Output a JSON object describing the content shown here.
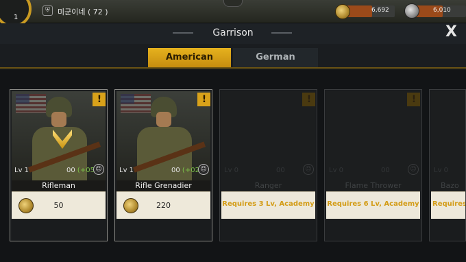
{
  "topbar": {
    "level": "1",
    "player_name": "미군이네 ( 72 )",
    "rank_icon": "shield-rank-icon",
    "gold": "6,692",
    "gold_fill": 0.55,
    "steel": "6,010",
    "steel_fill": 0.55
  },
  "window": {
    "title": "Garrison",
    "close_label": "X"
  },
  "tabs": [
    {
      "label": "American",
      "active": true
    },
    {
      "label": "German",
      "active": false
    }
  ],
  "units": [
    {
      "name": "Rifleman",
      "level": "Lv 1",
      "stat": "00",
      "stat_bonus": "(+05)",
      "cost": "50",
      "locked": false,
      "warn": "!"
    },
    {
      "name": "Rifle Grenadier",
      "level": "Lv 1",
      "stat": "00",
      "stat_bonus": "(+02)",
      "cost": "220",
      "locked": false,
      "warn": "!"
    },
    {
      "name": "Ranger",
      "level": "Lv 0",
      "stat": "00",
      "stat_bonus": "",
      "requirement": "Requires 3 Lv, Academy",
      "locked": true,
      "warn": "!"
    },
    {
      "name": "Flame Thrower",
      "level": "Lv 0",
      "stat": "00",
      "stat_bonus": "",
      "requirement": "Requires 6 Lv, Academy",
      "locked": true,
      "warn": "!"
    },
    {
      "name": "Bazo",
      "level": "Lv 0",
      "stat": "",
      "stat_bonus": "",
      "requirement": "Requires",
      "locked": true,
      "warn": ""
    }
  ],
  "colors": {
    "accent": "#d9a21a",
    "bonus_green": "#7cc24a",
    "requirement_text": "#d39c16"
  }
}
